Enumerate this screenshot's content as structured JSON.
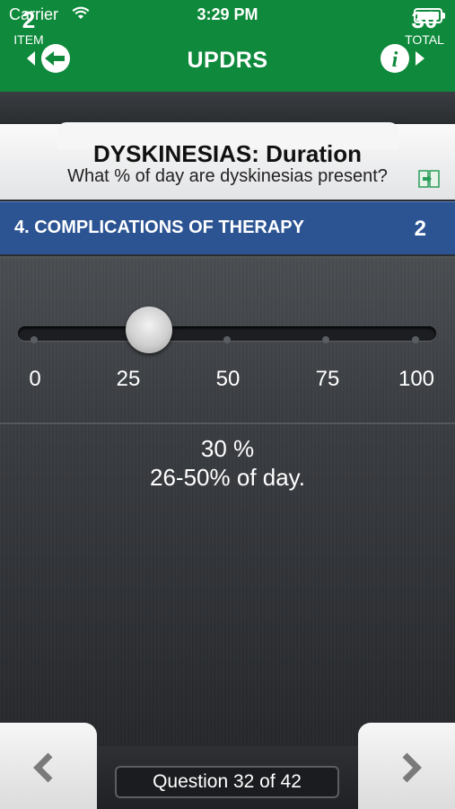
{
  "status_bar": {
    "carrier": "Carrier",
    "time": "3:29 PM"
  },
  "nav": {
    "title": "UPDRS"
  },
  "header": {
    "item_number": "2",
    "item_label": "ITEM",
    "total_number": "30",
    "total_label": "TOTAL",
    "question_title": "DYSKINESIAS: Duration",
    "question_subtitle": "What % of day are dyskinesias present?"
  },
  "section": {
    "label": "4. COMPLICATIONS OF THERAPY",
    "score": "2"
  },
  "slider": {
    "tick_labels": [
      "0",
      "25",
      "50",
      "75",
      "100"
    ],
    "value_percent": 30
  },
  "result": {
    "value_text": "30 %",
    "description": "26-50% of day."
  },
  "footer": {
    "question_counter": "Question 32 of 42"
  },
  "colors": {
    "nav_green": "#0f8a3c",
    "section_blue": "#2c5493"
  }
}
